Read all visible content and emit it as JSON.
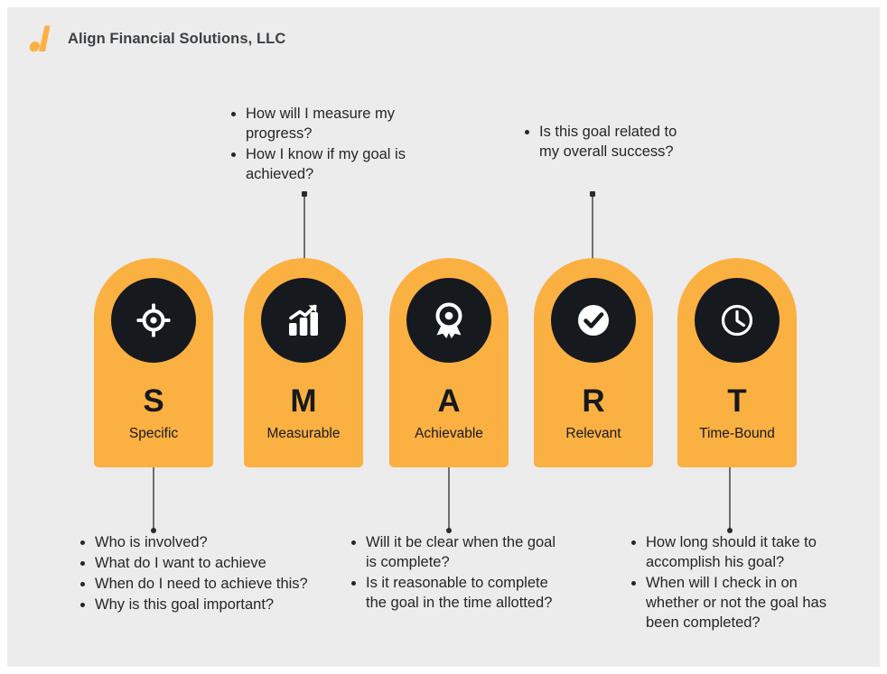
{
  "header": {
    "brand": "Align Financial Solutions, LLC",
    "logo_icon": "align-logo-icon"
  },
  "colors": {
    "accent_orange": "#FBB042",
    "dark": "#16191D",
    "canvas": "#ECECEC",
    "text": "#242628",
    "connector": "#6F6F6F"
  },
  "pillars": [
    {
      "letter": "S",
      "word": "Specific",
      "icon": "target-icon"
    },
    {
      "letter": "M",
      "word": "Measurable",
      "icon": "bar-chart-growth-icon"
    },
    {
      "letter": "A",
      "word": "Achievable",
      "icon": "award-ribbon-icon"
    },
    {
      "letter": "R",
      "word": "Relevant",
      "icon": "check-circle-icon"
    },
    {
      "letter": "T",
      "word": "Time-Bound",
      "icon": "clock-icon"
    }
  ],
  "callouts": {
    "measurable": {
      "items": [
        "How will I measure my progress?",
        "How I know if my goal is achieved?"
      ]
    },
    "relevant": {
      "items": [
        "Is this goal related to my overall success?"
      ]
    },
    "specific": {
      "items": [
        "Who is involved?",
        "What do I want to achieve",
        "When do I need to achieve this?",
        "Why is this goal important?"
      ]
    },
    "achievable": {
      "items": [
        "Will it be clear when the goal is complete?",
        "Is it reasonable to complete the goal in the time allotted?"
      ]
    },
    "time_bound": {
      "items": [
        "How long should it take to accomplish his goal?",
        "When will I check in on whether or not the goal has been completed?"
      ]
    }
  }
}
